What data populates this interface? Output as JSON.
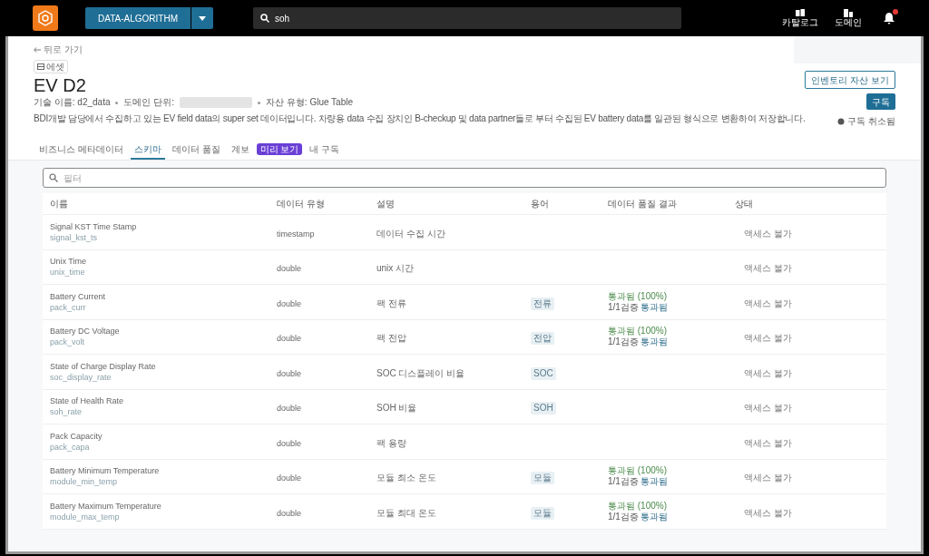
{
  "top_bar": {
    "workspace": "DATA-ALGORITHM",
    "search_value": "soh",
    "nav": [
      {
        "label": "카탈로그",
        "kind": "catalog"
      },
      {
        "label": "도메인",
        "kind": "domain"
      }
    ],
    "notification_dot": true
  },
  "header": {
    "back": "뒤로 가기",
    "asset_chip": "에셋",
    "title": "EV D2",
    "meta": [
      {
        "kind": "text",
        "text": "기술 이름: d2_data"
      },
      {
        "kind": "redacted",
        "text": "도메인 단위:"
      },
      {
        "kind": "text",
        "text": "자산 유형: Glue Table"
      }
    ],
    "description": "BDI개발 담당에서 수집하고 있는 EV field data의 super set 데이터입니다. 차량용 data 수집 장치인 B-checkup 및 data partner들로 부터 수집된 EV battery data를 일관된 형식으로 변환하여 저장합니다.",
    "inventory_button": "인벤토리 자산 보기",
    "subscribe_button": "구독",
    "unsubscribed": "구독 취소됨"
  },
  "tabs": [
    {
      "label": "비즈니스 메타데이터",
      "kind": "text",
      "selected": false
    },
    {
      "label": "스키마",
      "kind": "text",
      "selected": true
    },
    {
      "label": "데이터 품질",
      "kind": "text",
      "selected": false
    },
    {
      "label": "계보",
      "kind": "text",
      "selected": false
    },
    {
      "label": "미리 보기",
      "kind": "pill",
      "selected": false
    },
    {
      "label": "내 구독",
      "kind": "text",
      "selected": false
    }
  ],
  "filter": {
    "placeholder": "필터"
  },
  "table": {
    "columns": [
      "이름",
      "데이터 유형",
      "설명",
      "용어",
      "데이터 품질 결과",
      "상태"
    ],
    "rows": [
      {
        "name": "Signal KST Time Stamp",
        "field": "signal_kst_ts",
        "type": "timestamp",
        "description": "데이터 수집 시간",
        "term": "",
        "quality": "",
        "quality_detail": "",
        "quality_link": "",
        "status": "액세스 불가"
      },
      {
        "name": "Unix Time",
        "field": "unix_time",
        "type": "double",
        "description": "unix 시간",
        "term": "",
        "quality": "",
        "quality_detail": "",
        "quality_link": "",
        "status": "액세스 불가"
      },
      {
        "name": "Battery Current",
        "field": "pack_curr",
        "type": "double",
        "description": "팩 전류",
        "term": "전류",
        "quality": "통과됨 (100%)",
        "quality_detail": "1/1검증",
        "quality_link": "통과됨",
        "status": "액세스 불가"
      },
      {
        "name": "Battery DC Voltage",
        "field": "pack_volt",
        "type": "double",
        "description": "팩 전압",
        "term": "전압",
        "quality": "통과됨 (100%)",
        "quality_detail": "1/1검증",
        "quality_link": "통과됨",
        "status": "액세스 불가"
      },
      {
        "name": "State of Charge Display Rate",
        "field": "soc_display_rate",
        "type": "double",
        "description": "SOC 디스플레이 비율",
        "term": "SOC",
        "quality": "",
        "quality_detail": "",
        "quality_link": "",
        "status": "액세스 불가"
      },
      {
        "name": "State of Health Rate",
        "field": "soh_rate",
        "type": "double",
        "description": "SOH 비율",
        "term": "SOH",
        "quality": "",
        "quality_detail": "",
        "quality_link": "",
        "status": "액세스 불가"
      },
      {
        "name": "Pack Capacity",
        "field": "pack_capa",
        "type": "double",
        "description": "팩 용량",
        "term": "",
        "quality": "",
        "quality_detail": "",
        "quality_link": "",
        "status": "액세스 불가"
      },
      {
        "name": "Battery Minimum Temperature",
        "field": "module_min_temp",
        "type": "double",
        "description": "모듈 최소 온도",
        "term": "모듈",
        "quality": "통과됨 (100%)",
        "quality_detail": "1/1검증",
        "quality_link": "통과됨",
        "status": "액세스 불가"
      },
      {
        "name": "Battery Maximum Temperature",
        "field": "module_max_temp",
        "type": "double",
        "description": "모듈 최대 온도",
        "term": "모듈",
        "quality": "통과됨 (100%)",
        "quality_detail": "1/1검증",
        "quality_link": "통과됨",
        "status": "액세스 불가"
      }
    ]
  }
}
